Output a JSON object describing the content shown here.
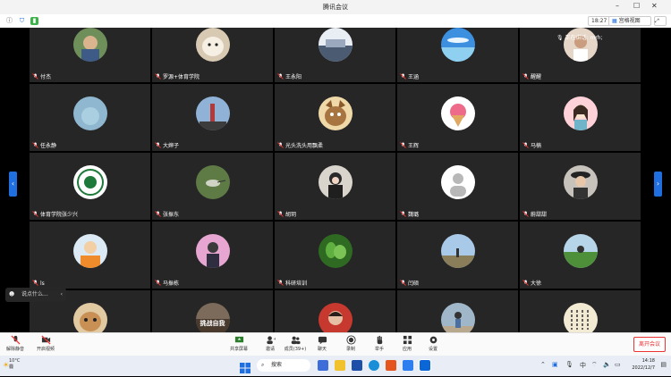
{
  "window": {
    "title": "腾讯会议"
  },
  "status": {
    "time": "18:27",
    "view_mode": "宫格视图"
  },
  "speaking": "正在讲话: mrh;",
  "participants": [
    {
      "name": "付杰",
      "avatar": "outdoor-photo"
    },
    {
      "name": "罗源+体育学院",
      "avatar": "dog"
    },
    {
      "name": "王永阳",
      "avatar": "sunset-scene"
    },
    {
      "name": "王涵",
      "avatar": "sky-sea"
    },
    {
      "name": "醒醒",
      "avatar": "person-photo"
    },
    {
      "name": "任永静",
      "avatar": "blue-sky"
    },
    {
      "name": "大婶子",
      "avatar": "tower"
    },
    {
      "name": "光头洗头用飘柔",
      "avatar": "cat-cartoon"
    },
    {
      "name": "王辉",
      "avatar": "ice-cream"
    },
    {
      "name": "马楠",
      "avatar": "girl-cartoon"
    },
    {
      "name": "体育学院张少兴",
      "avatar": "school-emblem"
    },
    {
      "name": "张振东",
      "avatar": "bird"
    },
    {
      "name": "胡玥",
      "avatar": "girl-photo"
    },
    {
      "name": "魏璐",
      "avatar": "default-person"
    },
    {
      "name": "蔚甜甜",
      "avatar": "girl-hat"
    },
    {
      "name": "ls",
      "avatar": "cartoon-boy"
    },
    {
      "name": "马振栋",
      "avatar": "pink-bg-person"
    },
    {
      "name": "科研培训",
      "avatar": "green-plant"
    },
    {
      "name": "闫硕",
      "avatar": "landscape"
    },
    {
      "name": "大徐",
      "avatar": "field"
    },
    {
      "name": "",
      "avatar": "kitten"
    },
    {
      "name": "",
      "avatar": "text-on-photo",
      "overlay_text": "挑战自我"
    },
    {
      "name": "",
      "avatar": "woman-photo"
    },
    {
      "name": "",
      "avatar": "outdoor-person"
    },
    {
      "name": "",
      "avatar": "calligraphy"
    }
  ],
  "chat": {
    "placeholder": "说点什么..."
  },
  "toolbar": {
    "mic": "解除静音",
    "video": "开启视频",
    "share": "共享屏幕",
    "invite": "邀请",
    "members": "成员(39+)",
    "chat": "聊天",
    "record": "录制",
    "raise": "举手",
    "apps": "应用",
    "settings": "设置",
    "leave": "离开会议"
  },
  "taskbar": {
    "temp": "10°C",
    "weather": "霾",
    "search": "搜索",
    "ime": "中",
    "time": "14:18",
    "date": "2022/12/7"
  },
  "colors": {
    "accent": "#1f6fe0",
    "leave": "#e33333",
    "tile": "#262626"
  }
}
